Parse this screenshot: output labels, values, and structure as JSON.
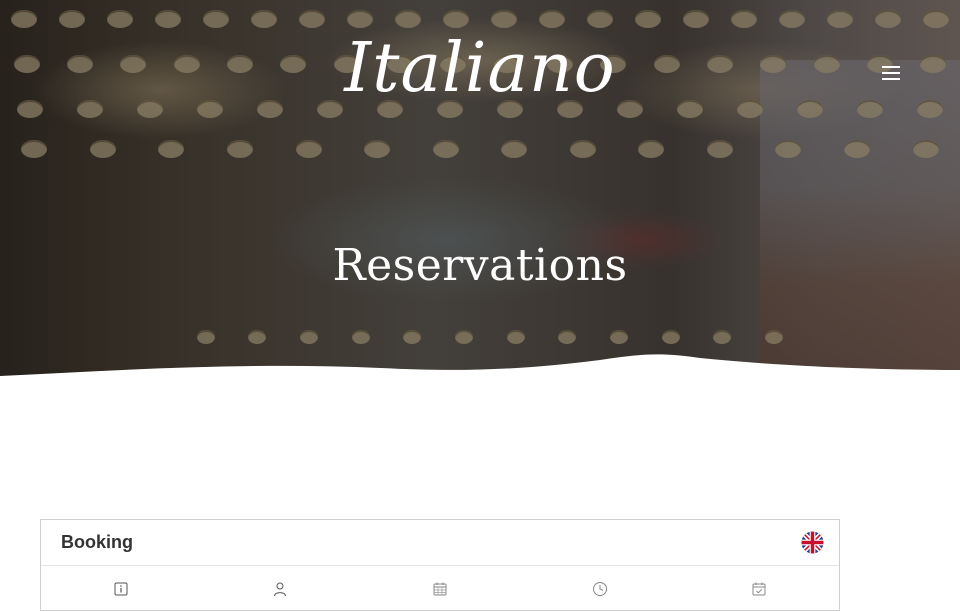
{
  "header": {
    "logo_text": "Italiano",
    "menu_icon": "hamburger-menu-icon"
  },
  "hero": {
    "title": "Reservations"
  },
  "booking": {
    "title": "Booking",
    "language_icon": "uk-flag-icon",
    "steps": [
      {
        "icon": "info-icon"
      },
      {
        "icon": "user-icon"
      },
      {
        "icon": "calendar-icon"
      },
      {
        "icon": "clock-icon"
      },
      {
        "icon": "calendar-check-icon"
      }
    ]
  },
  "colors": {
    "card_border": "#cfcfcf",
    "text_dark": "#333333",
    "icon_grey": "#777777"
  }
}
